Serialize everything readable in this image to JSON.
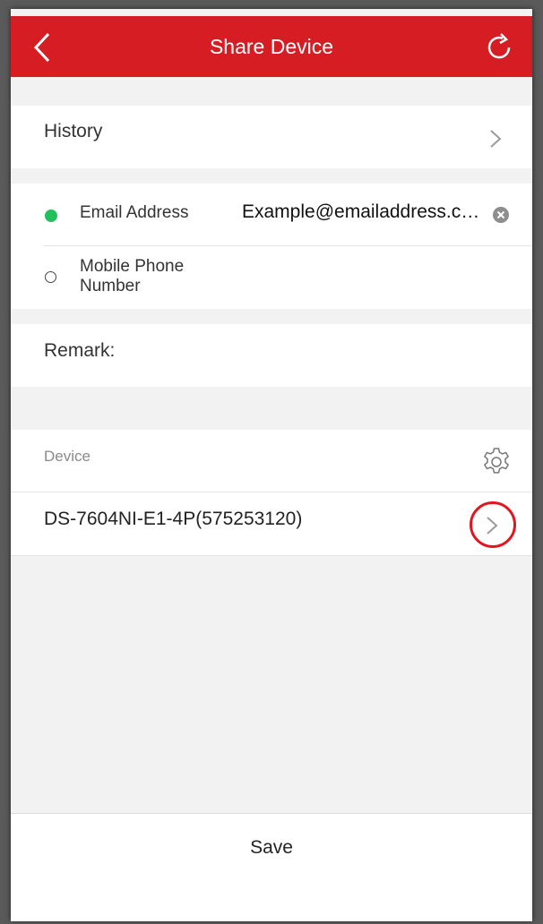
{
  "header": {
    "title": "Share Device",
    "back_icon": "chevron-left-icon",
    "refresh_icon": "refresh-icon",
    "color": "#d71d24"
  },
  "history": {
    "label": "History"
  },
  "contact": {
    "email_label": "Email Address",
    "email_value": "Example@emailaddress.com",
    "email_selected": true,
    "phone_label": "Mobile Phone Number",
    "phone_selected": false
  },
  "remark": {
    "label": "Remark:"
  },
  "device_section": {
    "label": "Device"
  },
  "device": {
    "name": "DS-7604NI-E1-4P(575253120)"
  },
  "footer": {
    "save_label": "Save"
  },
  "colors": {
    "accent_red": "#d71d24",
    "selected_green": "#22c05c",
    "annotation_red": "#e3161f"
  }
}
